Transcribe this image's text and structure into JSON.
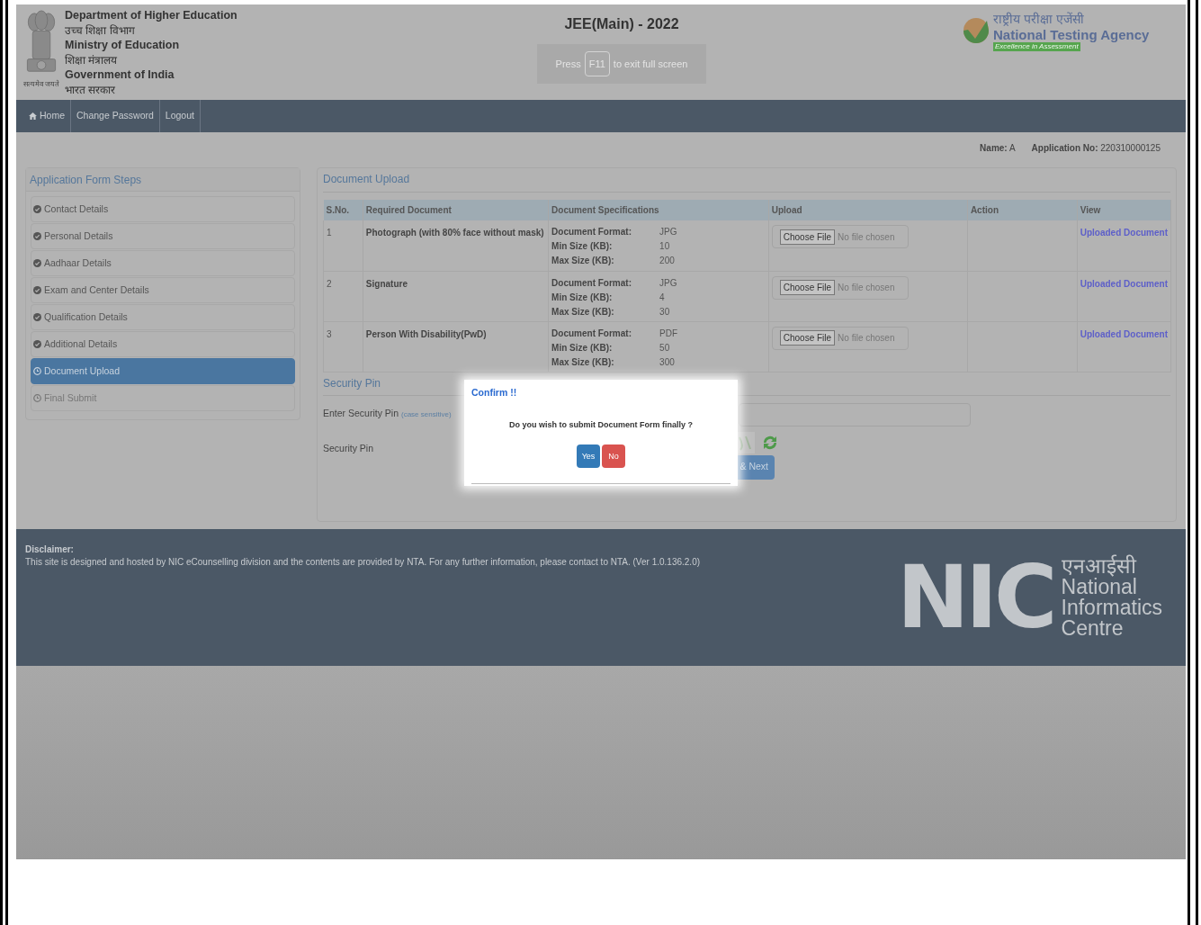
{
  "header": {
    "emblem_caption": "सत्यमेव जयते",
    "department_lines": [
      "Department of Higher Education",
      "उच्च शिक्षा विभाग",
      "Ministry of Education",
      "शिक्षा मंत्रालय",
      "Government of India",
      "भारत सरकार"
    ],
    "title": "JEE(Main) - 2022",
    "fullscreen_notice": {
      "before": "Press",
      "key": "F11",
      "after": "to exit full screen"
    },
    "agency": {
      "hindi": "राष्ट्रीय परीक्षा एजेंसी",
      "name": "National Testing Agency",
      "tagline": "Excellence in Assessment"
    }
  },
  "nav": [
    {
      "label": "Home"
    },
    {
      "label": "Change Password"
    },
    {
      "label": "Logout"
    }
  ],
  "user": {
    "name_label": "Name:",
    "name": "A",
    "app_label": "Application No:",
    "app_no": "220310000125"
  },
  "sidebar": {
    "title": "Application Form Steps",
    "items": [
      {
        "label": "Contact Details",
        "done": true,
        "selected": false
      },
      {
        "label": "Personal Details",
        "done": true,
        "selected": false
      },
      {
        "label": "Aadhaar Details",
        "done": true,
        "selected": false
      },
      {
        "label": "Exam and Center Details",
        "done": true,
        "selected": false
      },
      {
        "label": "Qualification Details",
        "done": true,
        "selected": false
      },
      {
        "label": "Additional Details",
        "done": true,
        "selected": false
      },
      {
        "label": "Document Upload",
        "done": false,
        "selected": true
      },
      {
        "label": "Final Submit",
        "done": false,
        "selected": false
      }
    ]
  },
  "document_upload": {
    "title": "Document Upload",
    "columns": [
      "S.No.",
      "Required Document",
      "Document Specifications",
      "Upload",
      "Action",
      "View"
    ],
    "rows": [
      {
        "sno": "1",
        "document": "Photograph (with 80% face without mask)",
        "specs": [
          [
            "Document Format:",
            "JPG"
          ],
          [
            "Min Size (KB):",
            "10"
          ],
          [
            "Max Size (KB):",
            "200"
          ]
        ],
        "upload_button": "Choose File",
        "upload_status": "No file chosen",
        "view": "Uploaded Document"
      },
      {
        "sno": "2",
        "document": "Signature",
        "specs": [
          [
            "Document Format:",
            "JPG"
          ],
          [
            "Min Size (KB):",
            "4"
          ],
          [
            "Max Size (KB):",
            "30"
          ]
        ],
        "upload_button": "Choose File",
        "upload_status": "No file chosen",
        "view": "Uploaded Document"
      },
      {
        "sno": "3",
        "document": "Person With Disability(PwD)",
        "specs": [
          [
            "Document Format:",
            "PDF"
          ],
          [
            "Min Size (KB):",
            "50"
          ],
          [
            "Max Size (KB):",
            "300"
          ]
        ],
        "upload_button": "Choose File",
        "upload_status": "No file chosen",
        "view": "Uploaded Document"
      }
    ]
  },
  "security": {
    "title": "Security Pin",
    "enter_label": "Enter Security Pin",
    "hint": "(case sensitive)",
    "pin_label": "Security Pin",
    "button": "& Next"
  },
  "dialog": {
    "title": "Confirm !!",
    "message": "Do you wish to submit Document Form finally ?",
    "buttons": [
      {
        "label": "Yes",
        "kind": "primary"
      },
      {
        "label": "No",
        "kind": "danger"
      }
    ]
  },
  "footer": {
    "disclaimer_title": "Disclaimer:",
    "disclaimer": "This site is designed and hosted by NIC eCounselling division and the contents are provided by NTA. For any further information, please contact to NTA. (Ver 1.0.136.2.0)",
    "nic": {
      "mark": "NIC",
      "hindi": "एनआईसी",
      "lines": [
        "National",
        "Informatics",
        "Centre"
      ]
    }
  }
}
